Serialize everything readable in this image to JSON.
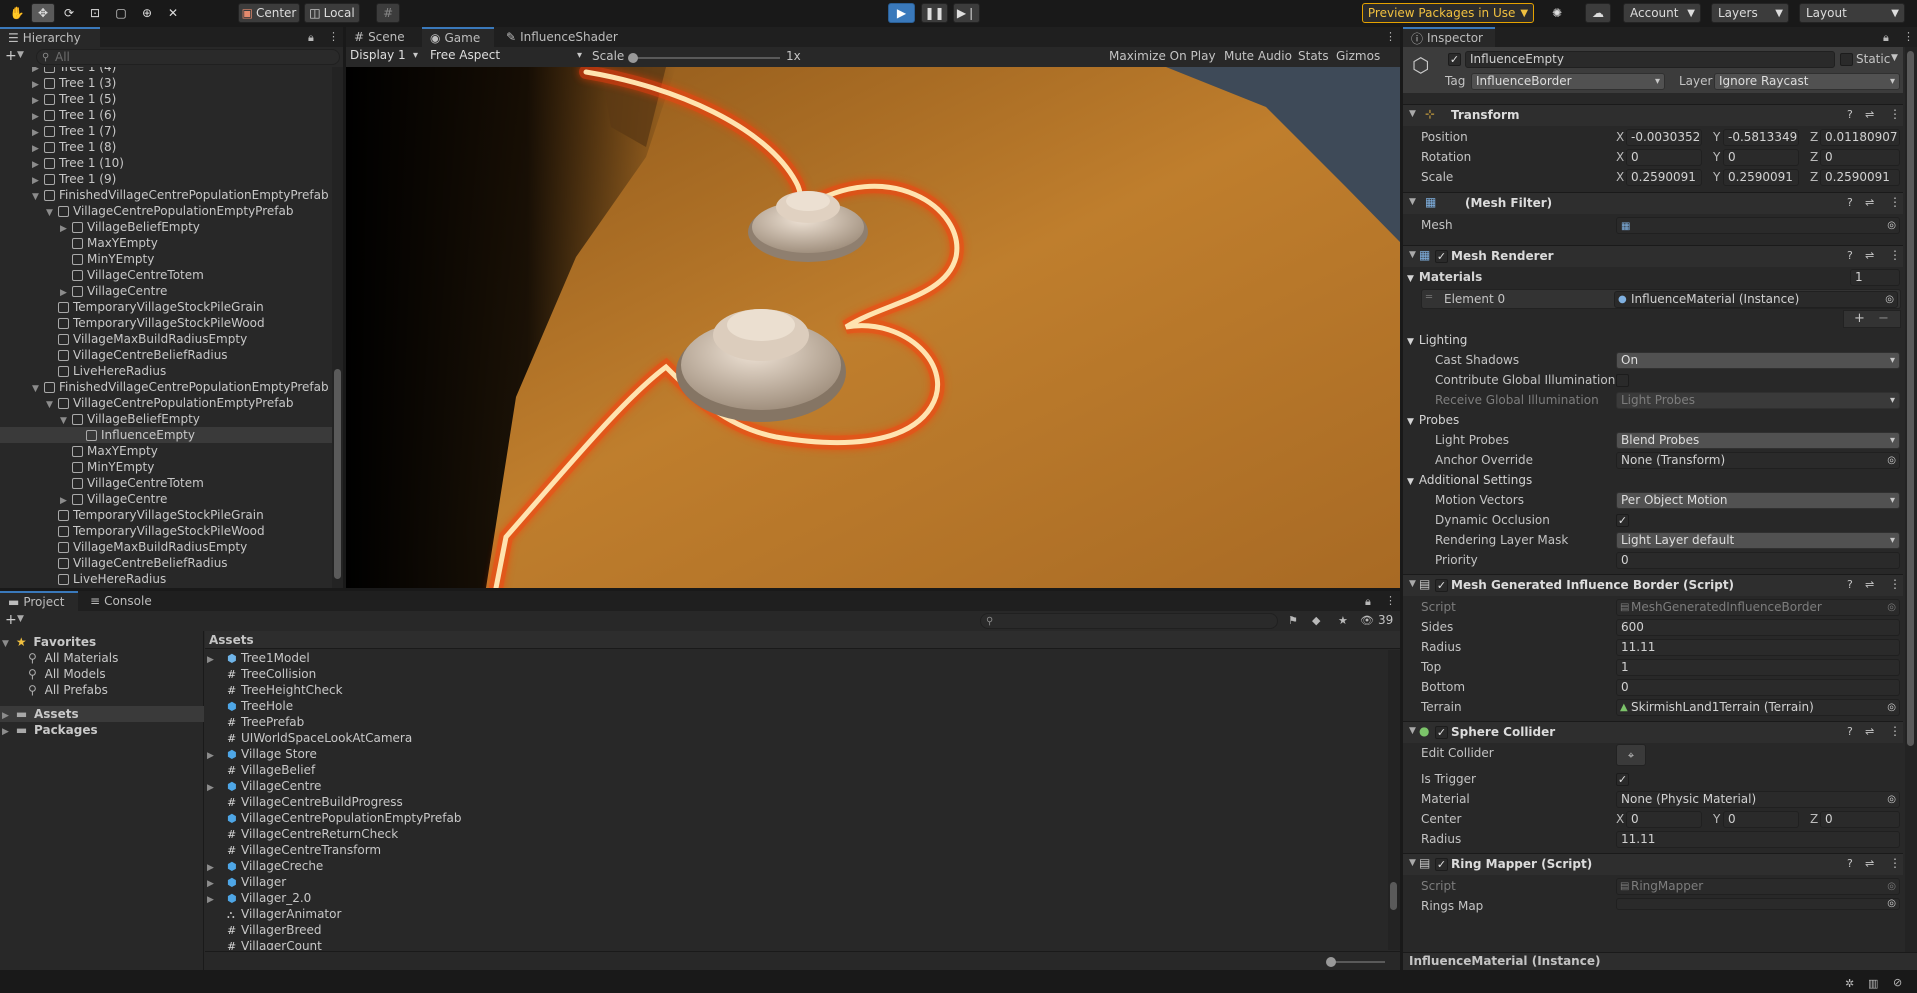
{
  "toolbar": {
    "pivot_label": "Center",
    "space_label": "Local",
    "preview_label": "Preview Packages in Use",
    "account_label": "Account",
    "layers_label": "Layers",
    "layout_label": "Layout"
  },
  "hierarchy": {
    "tab_label": "Hierarchy",
    "search_placeholder": "All",
    "rows": [
      {
        "label": "Tree 1 (4)",
        "indent": 0,
        "fold": "right"
      },
      {
        "label": "Tree 1 (3)",
        "indent": 0,
        "fold": "right"
      },
      {
        "label": "Tree 1 (5)",
        "indent": 0,
        "fold": "right"
      },
      {
        "label": "Tree 1 (6)",
        "indent": 0,
        "fold": "right"
      },
      {
        "label": "Tree 1 (7)",
        "indent": 0,
        "fold": "right"
      },
      {
        "label": "Tree 1 (8)",
        "indent": 0,
        "fold": "right"
      },
      {
        "label": "Tree 1 (10)",
        "indent": 0,
        "fold": "right"
      },
      {
        "label": "Tree 1 (9)",
        "indent": 0,
        "fold": "right"
      },
      {
        "label": "FinishedVillageCentrePopulationEmptyPrefab",
        "indent": 0,
        "fold": "down"
      },
      {
        "label": "VillageCentrePopulationEmptyPrefab",
        "indent": 1,
        "fold": "down"
      },
      {
        "label": "VillageBeliefEmpty",
        "indent": 2,
        "fold": "right"
      },
      {
        "label": "MaxYEmpty",
        "indent": 2,
        "fold": ""
      },
      {
        "label": "MinYEmpty",
        "indent": 2,
        "fold": ""
      },
      {
        "label": "VillageCentreTotem",
        "indent": 2,
        "fold": ""
      },
      {
        "label": "VillageCentre",
        "indent": 2,
        "fold": "right"
      },
      {
        "label": "TemporaryVillageStockPileGrain",
        "indent": 1,
        "fold": ""
      },
      {
        "label": "TemporaryVillageStockPileWood",
        "indent": 1,
        "fold": ""
      },
      {
        "label": "VillageMaxBuildRadiusEmpty",
        "indent": 1,
        "fold": ""
      },
      {
        "label": "VillageCentreBeliefRadius",
        "indent": 1,
        "fold": ""
      },
      {
        "label": "LiveHereRadius",
        "indent": 1,
        "fold": ""
      },
      {
        "label": "FinishedVillageCentrePopulationEmptyPrefab",
        "indent": 0,
        "fold": "down"
      },
      {
        "label": "VillageCentrePopulationEmptyPrefab",
        "indent": 1,
        "fold": "down"
      },
      {
        "label": "VillageBeliefEmpty",
        "indent": 2,
        "fold": "down"
      },
      {
        "label": "InfluenceEmpty",
        "indent": 3,
        "fold": "",
        "selected": true
      },
      {
        "label": "MaxYEmpty",
        "indent": 2,
        "fold": ""
      },
      {
        "label": "MinYEmpty",
        "indent": 2,
        "fold": ""
      },
      {
        "label": "VillageCentreTotem",
        "indent": 2,
        "fold": ""
      },
      {
        "label": "VillageCentre",
        "indent": 2,
        "fold": "right"
      },
      {
        "label": "TemporaryVillageStockPileGrain",
        "indent": 1,
        "fold": ""
      },
      {
        "label": "TemporaryVillageStockPileWood",
        "indent": 1,
        "fold": ""
      },
      {
        "label": "VillageMaxBuildRadiusEmpty",
        "indent": 1,
        "fold": ""
      },
      {
        "label": "VillageCentreBeliefRadius",
        "indent": 1,
        "fold": ""
      },
      {
        "label": "LiveHereRadius",
        "indent": 1,
        "fold": ""
      }
    ]
  },
  "game": {
    "tabs": [
      "Scene",
      "Game",
      "InfluenceShader"
    ],
    "display": "Display 1",
    "aspect": "Free Aspect",
    "scale_label": "Scale",
    "scale_value": "1x",
    "maximize_label": "Maximize On Play",
    "mute_label": "Mute Audio",
    "stats_label": "Stats",
    "gizmos_label": "Gizmos"
  },
  "project": {
    "tabs": [
      "Project",
      "Console"
    ],
    "hidden_count": "39",
    "favorites_label": "Favorites",
    "favorites": [
      "All Materials",
      "All Models",
      "All Prefabs"
    ],
    "roots": [
      "Assets",
      "Packages"
    ],
    "assets_header": "Assets",
    "assets": [
      {
        "label": "Tree1Model",
        "icon": "model",
        "fold": true
      },
      {
        "label": "TreeCollision",
        "icon": "script",
        "fold": false
      },
      {
        "label": "TreeHeightCheck",
        "icon": "script",
        "fold": false
      },
      {
        "label": "TreeHole",
        "icon": "prefab",
        "fold": false
      },
      {
        "label": "TreePrefab",
        "icon": "script",
        "fold": false
      },
      {
        "label": "UIWorldSpaceLookAtCamera",
        "icon": "script",
        "fold": false
      },
      {
        "label": "Village Store",
        "icon": "prefab",
        "fold": true
      },
      {
        "label": "VillageBelief",
        "icon": "script",
        "fold": false
      },
      {
        "label": "VillageCentre",
        "icon": "prefab",
        "fold": true
      },
      {
        "label": "VillageCentreBuildProgress",
        "icon": "script",
        "fold": false
      },
      {
        "label": "VillageCentrePopulationEmptyPrefab",
        "icon": "prefab",
        "fold": false
      },
      {
        "label": "VillageCentreReturnCheck",
        "icon": "script",
        "fold": false
      },
      {
        "label": "VillageCentreTransform",
        "icon": "script",
        "fold": false
      },
      {
        "label": "VillageCreche",
        "icon": "prefab",
        "fold": true
      },
      {
        "label": "Villager",
        "icon": "prefab",
        "fold": true
      },
      {
        "label": "Villager_2.0",
        "icon": "prefab",
        "fold": true
      },
      {
        "label": "VillagerAnimator",
        "icon": "animator",
        "fold": false
      },
      {
        "label": "VillagerBreed",
        "icon": "script",
        "fold": false
      },
      {
        "label": "VillagerCount",
        "icon": "script",
        "fold": false
      }
    ]
  },
  "inspector": {
    "tab_label": "Inspector",
    "object_name": "InfluenceEmpty",
    "static_label": "Static",
    "tag_label": "Tag",
    "tag_value": "InfluenceBorder",
    "layer_label": "Layer",
    "layer_value": "Ignore Raycast",
    "transform": {
      "title": "Transform",
      "position_label": "Position",
      "rotation_label": "Rotation",
      "scale_label": "Scale",
      "position": [
        "-0.00303526",
        "-0.5813349",
        "0.01180907"
      ],
      "rotation": [
        "0",
        "0",
        "0"
      ],
      "scale": [
        "0.2590091",
        "0.2590091",
        "0.2590091"
      ]
    },
    "mesh_filter": {
      "title": "(Mesh Filter)",
      "mesh_label": "Mesh"
    },
    "mesh_renderer": {
      "title": "Mesh Renderer",
      "materials_label": "Materials",
      "materials_count": "1",
      "element0_label": "Element 0",
      "element0_value": "InfluenceMaterial (Instance)",
      "lighting_label": "Lighting",
      "cast_shadows_label": "Cast Shadows",
      "cast_shadows_value": "On",
      "contribute_gi_label": "Contribute Global Illumination",
      "receive_gi_label": "Receive Global Illumination",
      "receive_gi_value": "Light Probes",
      "probes_label": "Probes",
      "light_probes_label": "Light Probes",
      "light_probes_value": "Blend Probes",
      "anchor_label": "Anchor Override",
      "anchor_value": "None (Transform)",
      "additional_label": "Additional Settings",
      "motion_label": "Motion Vectors",
      "motion_value": "Per Object Motion",
      "dynamic_occlusion_label": "Dynamic Occlusion",
      "rendering_mask_label": "Rendering Layer Mask",
      "rendering_mask_value": "Light Layer default",
      "priority_label": "Priority",
      "priority_value": "0"
    },
    "influence_border": {
      "title": "Mesh Generated Influence Border (Script)",
      "script_label": "Script",
      "script_value": "MeshGeneratedInfluenceBorder",
      "sides_label": "Sides",
      "sides_value": "600",
      "radius_label": "Radius",
      "radius_value": "11.11",
      "top_label": "Top",
      "top_value": "1",
      "bottom_label": "Bottom",
      "bottom_value": "0",
      "terrain_label": "Terrain",
      "terrain_value": "SkirmishLand1Terrain (Terrain)"
    },
    "sphere_collider": {
      "title": "Sphere Collider",
      "edit_label": "Edit Collider",
      "trigger_label": "Is Trigger",
      "material_label": "Material",
      "material_value": "None (Physic Material)",
      "center_label": "Center",
      "center": [
        "0",
        "0",
        "0"
      ],
      "radius_label": "Radius",
      "radius_value": "11.11"
    },
    "ring_mapper": {
      "title": "Ring Mapper (Script)",
      "script_label": "Script",
      "script_value": "RingMapper",
      "rings_label": "Rings Map"
    },
    "footer_label": "InfluenceMaterial (Instance)"
  },
  "colors": {
    "accent": "#3a79bb",
    "selected_row": "#2c5d87",
    "preview_border": "#e5a200",
    "terrain": "#b8792a",
    "glow": "#ff5a1e"
  }
}
